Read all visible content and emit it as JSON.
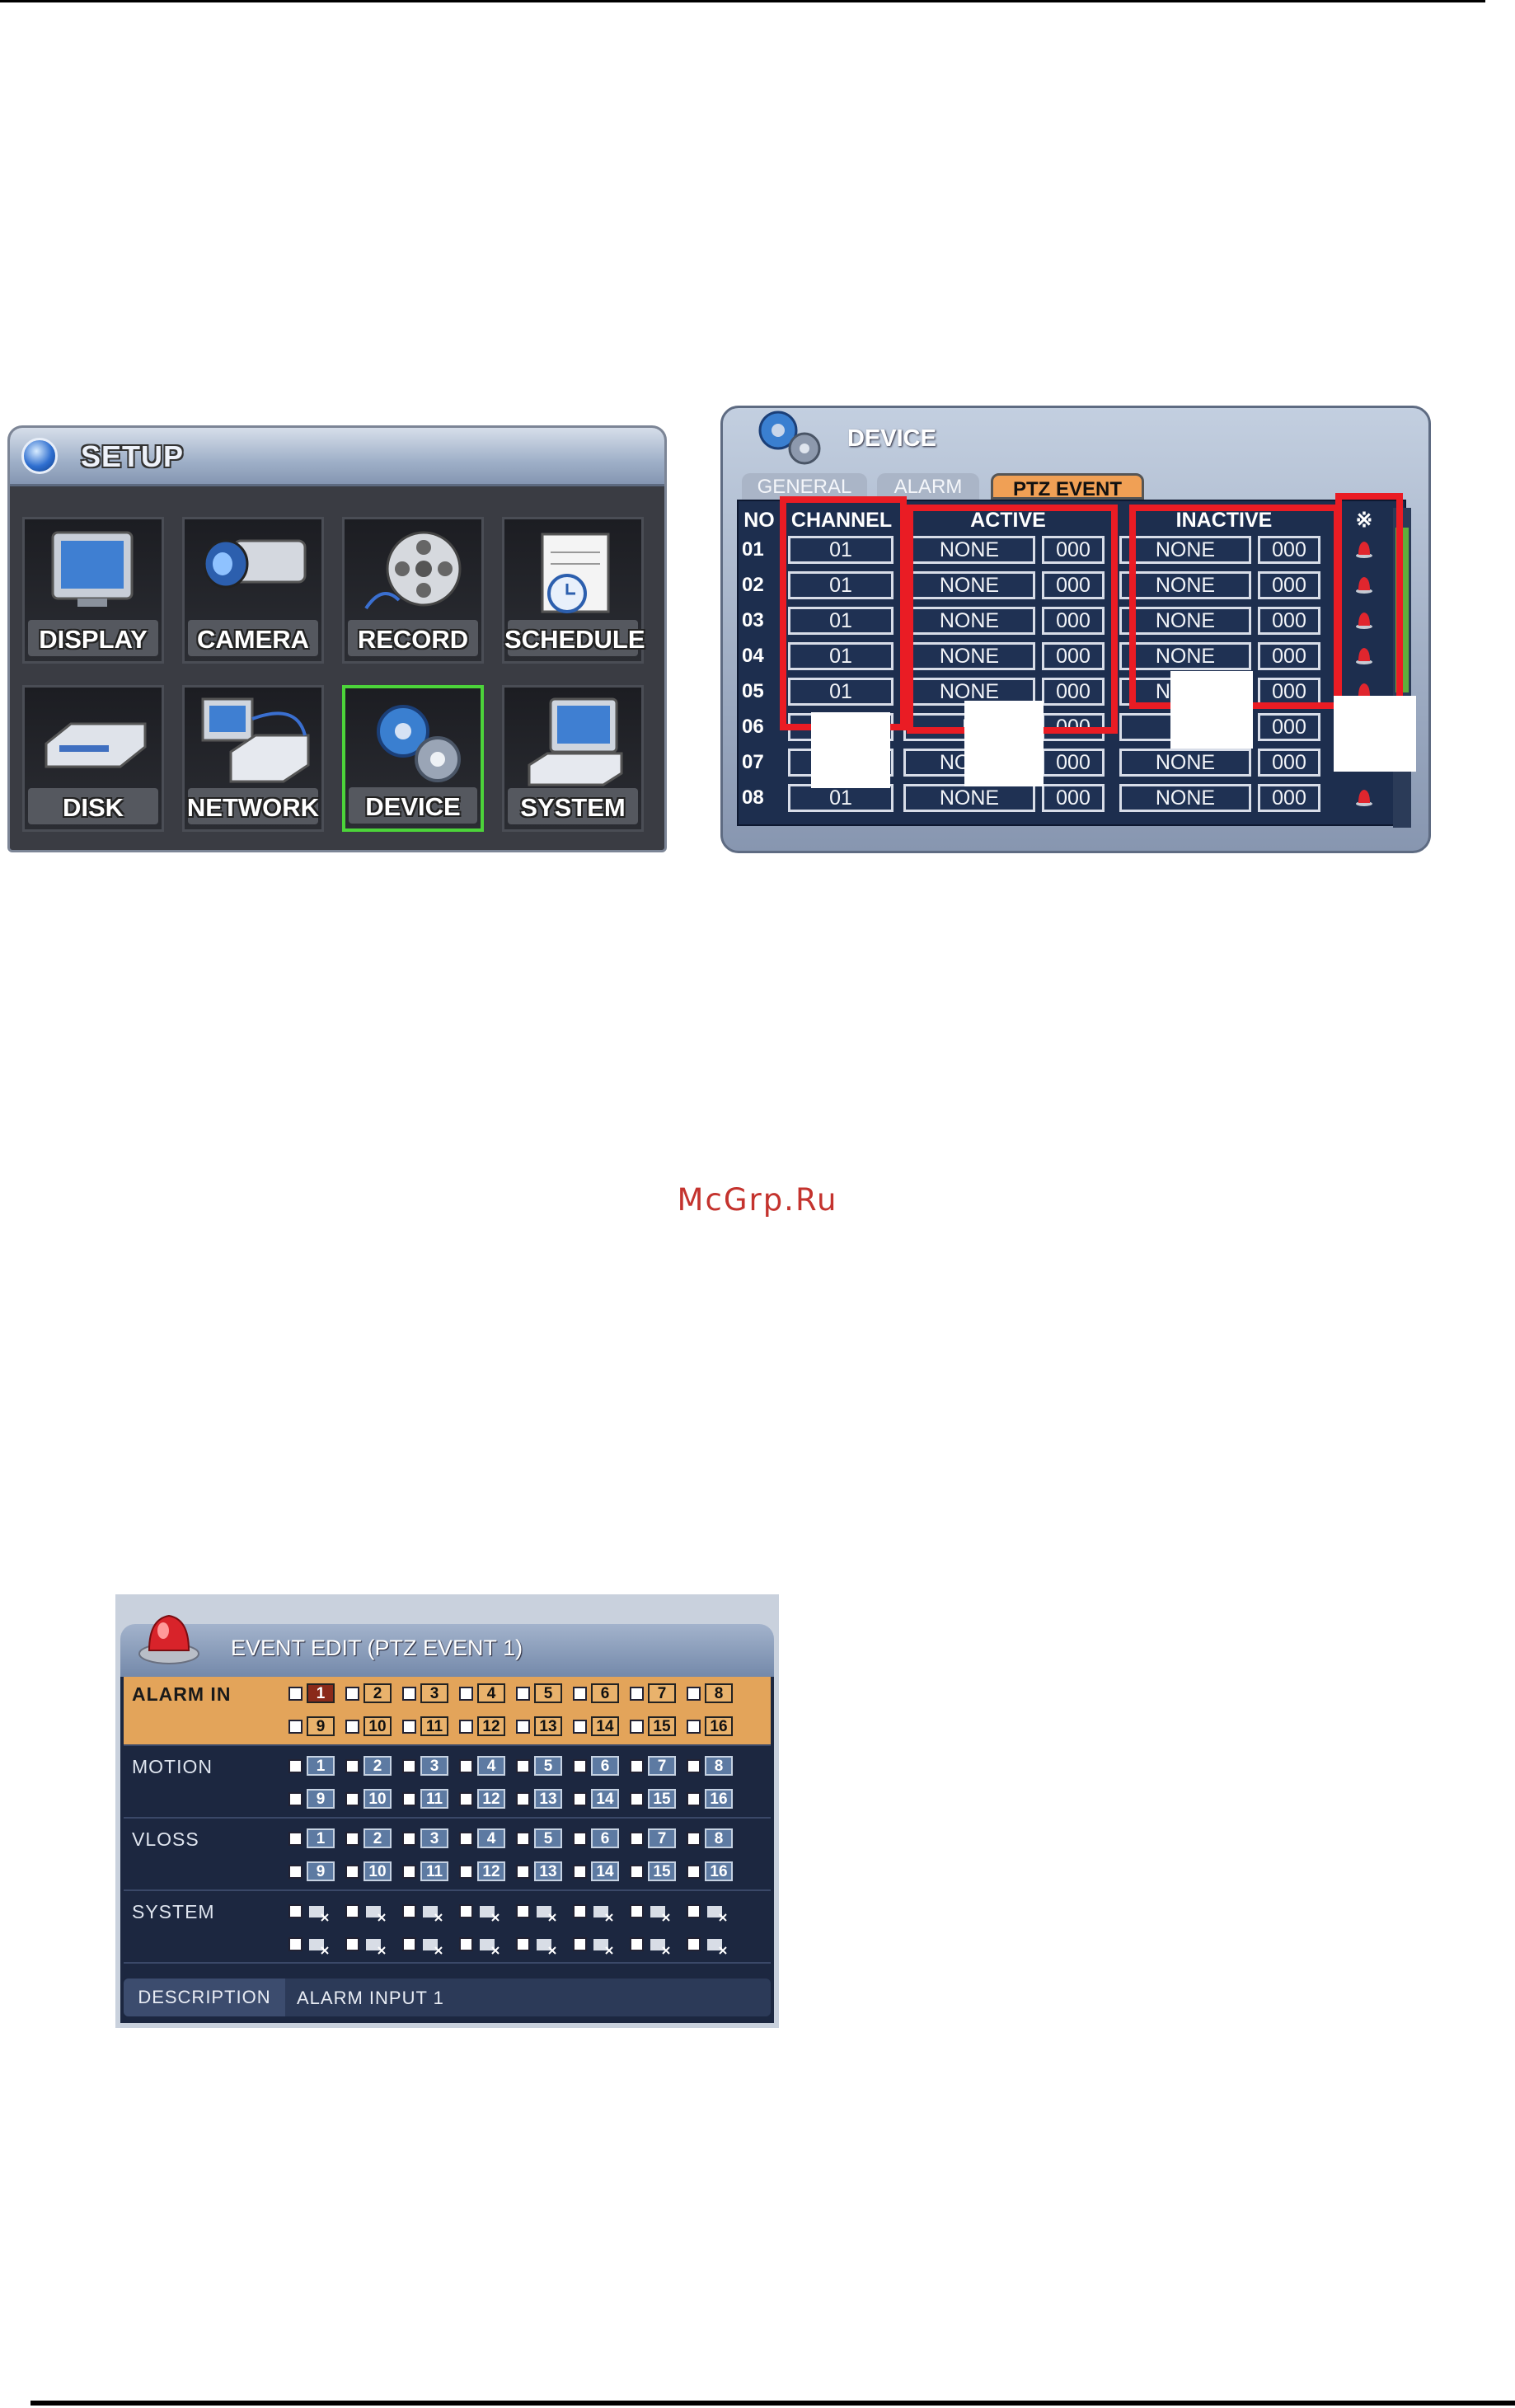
{
  "setup": {
    "title": "SETUP",
    "tiles": [
      {
        "label": "DISPLAY",
        "icon": "monitor-icon"
      },
      {
        "label": "CAMERA",
        "icon": "camera-icon"
      },
      {
        "label": "RECORD",
        "icon": "film-reel-icon"
      },
      {
        "label": "SCHEDULE",
        "icon": "notepad-clock-icon"
      },
      {
        "label": "DISK",
        "icon": "disk-drive-icon"
      },
      {
        "label": "NETWORK",
        "icon": "network-devices-icon"
      },
      {
        "label": "DEVICE",
        "icon": "gears-icon",
        "selected": true
      },
      {
        "label": "SYSTEM",
        "icon": "computer-icon"
      }
    ]
  },
  "device": {
    "title": "DEVICE",
    "tabs": [
      "GENERAL",
      "ALARM",
      "PTZ EVENT"
    ],
    "active_tab": "PTZ EVENT",
    "columns": {
      "no": "NO",
      "channel": "CHANNEL",
      "active": "ACTIVE",
      "inactive": "INACTIVE",
      "event": "※"
    },
    "rows": [
      {
        "no": "01",
        "channel": "01",
        "active": "NONE",
        "active_preset": "000",
        "inactive": "NONE",
        "inactive_preset": "000"
      },
      {
        "no": "02",
        "channel": "01",
        "active": "NONE",
        "active_preset": "000",
        "inactive": "NONE",
        "inactive_preset": "000"
      },
      {
        "no": "03",
        "channel": "01",
        "active": "NONE",
        "active_preset": "000",
        "inactive": "NONE",
        "inactive_preset": "000"
      },
      {
        "no": "04",
        "channel": "01",
        "active": "NONE",
        "active_preset": "000",
        "inactive": "NONE",
        "inactive_preset": "000"
      },
      {
        "no": "05",
        "channel": "01",
        "active": "NONE",
        "active_preset": "000",
        "inactive": "NONE",
        "inactive_preset": "000"
      },
      {
        "no": "06",
        "channel": "",
        "active": "N",
        "active_preset": "000",
        "inactive": "",
        "inactive_preset": "000"
      },
      {
        "no": "07",
        "channel": "",
        "active": "NONE",
        "active_preset": "000",
        "inactive": "NONE",
        "inactive_preset": "000"
      },
      {
        "no": "08",
        "channel": "01",
        "active": "NONE",
        "active_preset": "000",
        "inactive": "NONE",
        "inactive_preset": "000"
      }
    ],
    "highlight_color": "#ea1c24"
  },
  "watermark": "McGrp.Ru",
  "event_edit": {
    "title": "EVENT EDIT (PTZ EVENT 1)",
    "sections": [
      {
        "label": "ALARM IN",
        "highlight": true
      },
      {
        "label": "MOTION"
      },
      {
        "label": "VLOSS"
      },
      {
        "label": "SYSTEM"
      }
    ],
    "numbers": [
      "1",
      "2",
      "3",
      "4",
      "5",
      "6",
      "7",
      "8",
      "9",
      "10",
      "11",
      "12",
      "13",
      "14",
      "15",
      "16"
    ],
    "description_label": "DESCRIPTION",
    "description_value": "ALARM INPUT 1"
  }
}
